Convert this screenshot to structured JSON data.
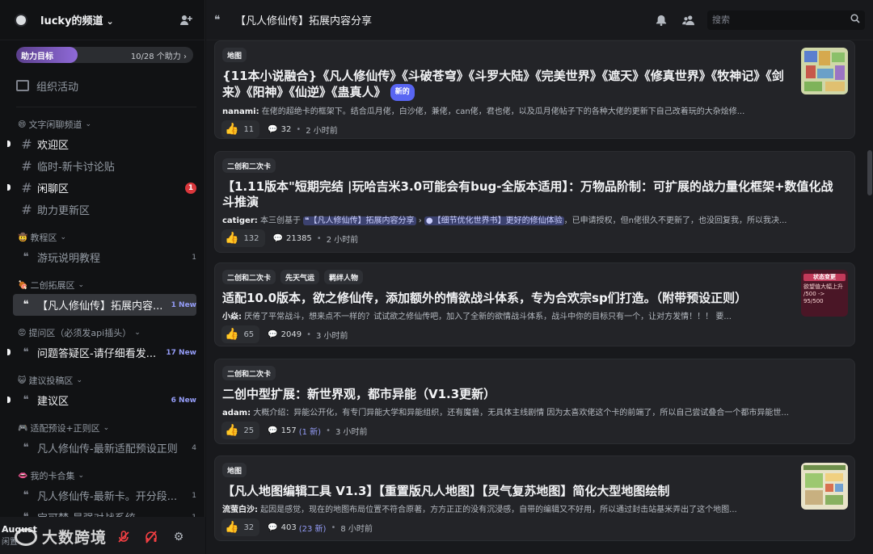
{
  "server": {
    "name": "lucky的频道"
  },
  "boost": {
    "label": "助力目标",
    "count": "10/28 个助力",
    "chevron": "›",
    "progress": 0.357
  },
  "events": {
    "label": "组织活动"
  },
  "categories": [
    {
      "emoji": "😄",
      "name": "文字闲聊频道",
      "channels": [
        {
          "type": "text",
          "name": "欢迎区",
          "unread": true
        },
        {
          "type": "text",
          "name": "临时-新卡讨论贴",
          "unread": false
        },
        {
          "type": "text",
          "name": "闲聊区",
          "unread": true,
          "badge": "1"
        },
        {
          "type": "text",
          "name": "助力更新区",
          "unread": false
        }
      ]
    },
    {
      "emoji": "🤠",
      "name": "教程区",
      "channels": [
        {
          "type": "forum",
          "name": "游玩说明教程",
          "count": "1"
        }
      ]
    },
    {
      "emoji": "🍖",
      "name": "二创拓展区",
      "channels": [
        {
          "type": "forum",
          "name": "【凡人修仙传】拓展内容...",
          "new": "1 New",
          "active": true
        }
      ]
    },
    {
      "emoji": "😡",
      "name": "提问区（必须发api插头）",
      "channels": [
        {
          "type": "forum",
          "name": "问题答疑区-请仔细看发...",
          "new": "17 New",
          "unread": true
        }
      ]
    },
    {
      "emoji": "😺",
      "name": "建议投稿区",
      "channels": [
        {
          "type": "forum",
          "name": "建议区",
          "new": "6 New",
          "unread": true
        }
      ]
    },
    {
      "emoji": "🎮",
      "name": "适配预设+正则区",
      "channels": [
        {
          "type": "forum",
          "name": "凡人修仙传-最新适配预设正则",
          "count": "4"
        }
      ]
    },
    {
      "emoji": "👄",
      "name": "我的卡合集",
      "channels": [
        {
          "type": "forum",
          "name": "凡人修仙传-最新卡。开分段...",
          "count": "1"
        },
        {
          "type": "forum",
          "name": "宝可梦-最强对战系统",
          "count": "1"
        }
      ]
    }
  ],
  "user": {
    "name": "August",
    "status": "闲置"
  },
  "watermark": "大数跨境",
  "topbar": {
    "title": "【凡人修仙传】拓展内容分享",
    "search_placeholder": "搜索"
  },
  "posts": [
    {
      "tags": [
        "地图"
      ],
      "title": "{11本小说融合}《凡人修仙传》《斗破苍穹》《斗罗大陆》《完美世界》《遮天》《修真世界》《牧神记》《剑来》《阳神》《仙逆》《蛊真人》",
      "new_label": "新的",
      "author": "nanami:",
      "preview": " 在佬的超绝卡的框架下。结合瓜月佬，白沙佬，兼佬，can佬，君也佬，以及瓜月佬帖子下的各种大佬的更新下自己改着玩的大杂烩修...",
      "likes": "11",
      "messages": "32",
      "new_messages": "",
      "time": "2 小时前",
      "thumb": "map"
    },
    {
      "tags": [
        "二创和二次卡"
      ],
      "title": "【1.11版本\"短期完结 |玩哈吉米3.0可能会有bug-全版本适用】：万物品阶制：可扩展的战力量化框架+数值化战斗推演",
      "author": "catiger:",
      "preview_a": " 本三创基于 ",
      "mention1": "【凡人修仙传】拓展内容分享",
      "mention2": "【细节优化世界书】更好的修仙体验",
      "preview_b": "，已申请授权，但n佬很久不更新了，也没回复我，所以我决...",
      "likes": "132",
      "messages": "21385",
      "new_messages": "",
      "time": "2 小时前"
    },
    {
      "tags": [
        "二创和二次卡",
        "先天气运",
        "羁绊人物"
      ],
      "title": "适配10.0版本，欲之修仙传，添加额外的情欲战斗体系，专为合欢宗sp们打造。（附带预设正则）",
      "author": "小焱:",
      "preview": " 厌倦了平常战斗，想来点不一样的？试试欲之修仙传吧，加入了全新的欲情战斗体系，战斗中你的目标只有一个，让对方发情！！！ 要...",
      "likes": "65",
      "messages": "2049",
      "new_messages": "",
      "time": "3 小时前",
      "thumb": "status",
      "thumb_text": "状态变更",
      "thumb_line1": "欲望值大幅上升",
      "thumb_line2": "/500 -> 95/500"
    },
    {
      "tags": [
        "二创和二次卡"
      ],
      "title": "二创中型扩展：新世界观，都市异能（V1.3更新）",
      "author": "adam:",
      "preview": " 大概介绍：异能公开化，有专门异能大学和异能组织，还有魔兽，无具体主线剧情 因为太喜欢佬这个卡的前端了，所以自己尝试叠合一个都市异能世...",
      "likes": "25",
      "messages": "157",
      "new_messages": "(1 新)",
      "time": "3 小时前"
    },
    {
      "tags": [
        "地图"
      ],
      "title": "【凡人地图编辑工具 V1.3】【重置版凡人地图】【灵气复苏地图】简化大型地图绘制",
      "author": "流萤白沙:",
      "preview": " 起因是感觉，现在的地图布局位置不符合原著，方方正正的没有沉浸感，自带的编辑又不好用，所以通过封击站基米弄出了这个地图...",
      "likes": "32",
      "messages": "403",
      "new_messages": "(23 新)",
      "time": "8 小时前",
      "thumb": "editor"
    }
  ]
}
